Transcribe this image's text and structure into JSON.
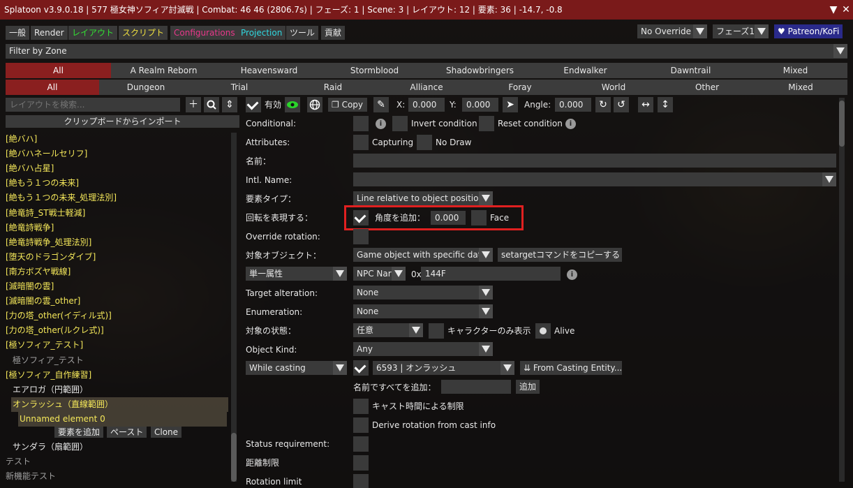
{
  "title": "Splatoon v3.9.0.18 | 577 極女神ソフィア討滅戦 | Combat: 46 46 (2806.7s) | フェーズ: 1 | Scene: 3 | レイアウト: 12 | 要素: 36 | -14.7, -0.8",
  "menu": {
    "general": "一般",
    "render": "Render",
    "layout": "レイアウト",
    "script": "スクリプト",
    "configurations": "Configurations",
    "projection": "Projection",
    "tools": "ツール",
    "contrib": "貢献"
  },
  "override": "No Override",
  "phase": "フェーズ1",
  "patreon": "♥ Patreon/KoFi",
  "filter_zone": "Filter by Zone",
  "expansions": [
    "All",
    "A Realm Reborn",
    "Heavensward",
    "Stormblood",
    "Shadowbringers",
    "Endwalker",
    "Dawntrail",
    "Mixed"
  ],
  "content_types": [
    "All",
    "Dungeon",
    "Trial",
    "Raid",
    "Alliance",
    "Foray",
    "World",
    "Other",
    "Mixed"
  ],
  "search_placeholder": "レイアウトを検索...",
  "import_clipboard": "クリップボードからインポート",
  "tree": [
    {
      "label": "[絶バハ]",
      "yellow": true,
      "indent": 0
    },
    {
      "label": "[絶バハネールセリフ]",
      "yellow": true,
      "indent": 0
    },
    {
      "label": "[絶バハ占星]",
      "yellow": true,
      "indent": 0
    },
    {
      "label": "[絶もう１つの未来]",
      "yellow": true,
      "indent": 0
    },
    {
      "label": "[絶もう１つの未来_処理法別]",
      "yellow": true,
      "indent": 0
    },
    {
      "label": "[絶竜詩_ST戦士軽減]",
      "yellow": true,
      "indent": 0
    },
    {
      "label": "[絶竜詩戦争]",
      "yellow": true,
      "indent": 0
    },
    {
      "label": "[絶竜詩戦争_処理法別]",
      "yellow": true,
      "indent": 0
    },
    {
      "label": "[堕天のドラゴンダイブ]",
      "yellow": true,
      "indent": 0
    },
    {
      "label": "[南方ボズヤ戦線]",
      "yellow": true,
      "indent": 0
    },
    {
      "label": "[滅暗闇の雲]",
      "yellow": true,
      "indent": 0
    },
    {
      "label": "[滅暗闇の雲_other]",
      "yellow": true,
      "indent": 0
    },
    {
      "label": "[力の塔_other(イディル式)]",
      "yellow": true,
      "indent": 0
    },
    {
      "label": "[力の塔_other(ルクレ式)]",
      "yellow": true,
      "indent": 0
    },
    {
      "label": "[極ソフィア_テスト]",
      "yellow": true,
      "indent": 0
    },
    {
      "label": "極ソフィア_テスト",
      "yellow": false,
      "indent": 1,
      "dim": true
    },
    {
      "label": "[極ソフィア_自作練習]",
      "yellow": true,
      "indent": 0
    },
    {
      "label": "エアロガ（円範囲）",
      "yellow": false,
      "indent": 1
    },
    {
      "label": "オンラッシュ（直線範囲）",
      "yellow": true,
      "indent": 1,
      "selected": true
    },
    {
      "label": "Unnamed element 0",
      "yellow": true,
      "indent": 2,
      "selected": true
    }
  ],
  "tree_actions": {
    "add_element": "要素を追加",
    "paste": "ペースト",
    "clone": "Clone"
  },
  "tree_after": [
    {
      "label": "サンダラ（扇範囲）",
      "indent": 1
    },
    {
      "label": "テスト",
      "indent": 0,
      "dim": true
    },
    {
      "label": "新機能テスト",
      "indent": 0,
      "dim": true
    }
  ],
  "toolbar": {
    "enabled": "有効",
    "copy": "Copy",
    "x_label": "X:",
    "x_value": "0.000",
    "y_label": "Y:",
    "y_value": "0.000",
    "angle_label": "Angle:",
    "angle_value": "0.000"
  },
  "rows": {
    "conditional": "Conditional:",
    "invert": "Invert condition",
    "reset": "Reset condition",
    "attributes": "Attributes:",
    "capturing": "Capturing",
    "no_draw": "No Draw",
    "name": "名前：",
    "intl_name": "Intl. Name:",
    "element_type": "要素タイプ：",
    "element_type_value": "Line relative to object position",
    "rotation": "回転を表現する：",
    "add_angle": "角度を追加：",
    "add_angle_value": "0.000",
    "face": "Face",
    "override_rotation": "Override rotation:",
    "target_object": "対象オブジェクト：",
    "target_object_value": "Game object with specific data",
    "copy_settarget": "setargetコマンドをコピーする",
    "single_attr": "単一属性",
    "npc_name": "NPC Nar",
    "hex_prefix": "0x",
    "hex_value": "144F",
    "target_alteration": "Target alteration:",
    "target_alteration_value": "None",
    "enumeration": "Enumeration:",
    "enumeration_value": "None",
    "target_state": "対象の状態：",
    "target_state_value": "任意",
    "character_only": "キャラクターのみ表示",
    "alive": "Alive",
    "object_kind": "Object Kind:",
    "object_kind_value": "Any",
    "while_casting": "While casting",
    "cast_value": "6593 | オンラッシュ",
    "from_casting": "From Casting Entity...",
    "add_all_by_name": "名前ですべてを追加：",
    "add": "追加",
    "cast_time_limit": "キャスト時間による制限",
    "derive_rotation": "Derive rotation from cast info",
    "status_requirement": "Status requirement:",
    "distance_limit": "距離制限",
    "rotation_limit": "Rotation limit"
  }
}
